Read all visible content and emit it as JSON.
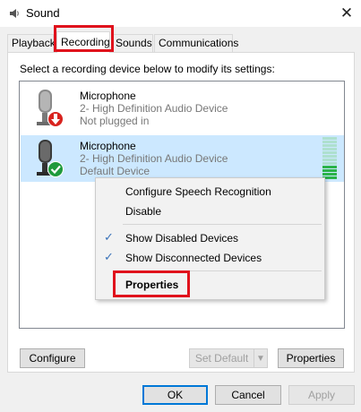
{
  "window": {
    "title": "Sound",
    "close_glyph": "✕"
  },
  "tabs": [
    {
      "label": "Playback",
      "active": false
    },
    {
      "label": "Recording",
      "active": true
    },
    {
      "label": "Sounds",
      "active": false
    },
    {
      "label": "Communications",
      "active": false
    }
  ],
  "instruction": "Select a recording device below to modify its settings:",
  "devices": [
    {
      "name": "Microphone",
      "description": "2- High Definition Audio Device",
      "status": "Not plugged in",
      "badge_icon": "red-down-arrow-icon",
      "selected": false
    },
    {
      "name": "Microphone",
      "description": "2- High Definition Audio Device",
      "status": "Default Device",
      "badge_icon": "green-check-icon",
      "selected": true,
      "level": 0.3
    }
  ],
  "context_menu": {
    "items": [
      {
        "label": "Configure Speech Recognition",
        "checked": false
      },
      {
        "label": "Disable",
        "checked": false
      },
      {
        "label": "Show Disabled Devices",
        "checked": true
      },
      {
        "label": "Show Disconnected Devices",
        "checked": true
      },
      {
        "label": "Properties",
        "checked": false,
        "bold": true
      }
    ],
    "check_glyph": "✓"
  },
  "buttons": {
    "configure": "Configure",
    "set_default": "Set Default",
    "properties": "Properties",
    "ok": "OK",
    "cancel": "Cancel",
    "apply": "Apply",
    "split_arrow": "▼"
  },
  "colors": {
    "highlight_red": "#e0121c",
    "selection_blue": "#cce8ff",
    "meter_green": "#2cb34a",
    "meter_empty": "#aee0cf",
    "check_blue": "#3b73b9"
  }
}
